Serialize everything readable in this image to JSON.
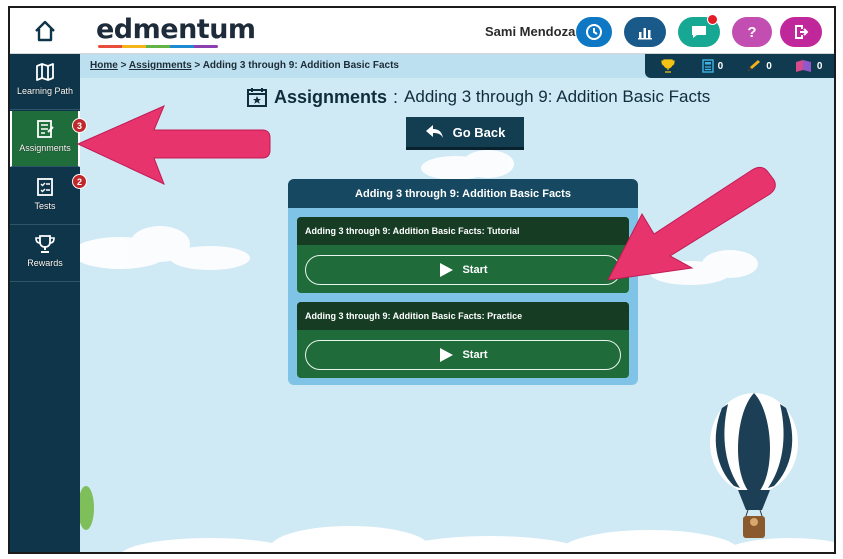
{
  "header": {
    "brand": "edmentum",
    "user_name": "Sami Mendoza",
    "icons": [
      "home-icon",
      "clock-icon",
      "chart-icon",
      "chat-icon",
      "help-icon",
      "exit-icon"
    ],
    "help_label": "?"
  },
  "sidebar": {
    "items": [
      {
        "label": "Learning Path",
        "icon": "map-icon"
      },
      {
        "label": "Assignments",
        "icon": "assignment-icon",
        "badge": "3"
      },
      {
        "label": "Tests",
        "icon": "checklist-icon",
        "badge": "2"
      },
      {
        "label": "Rewards",
        "icon": "trophy-icon"
      }
    ]
  },
  "breadcrumb": {
    "home": "Home",
    "sep1": ">",
    "assignments": "Assignments",
    "sep2": ">",
    "current": "Adding 3 through 9: Addition Basic Facts"
  },
  "stats": {
    "trophies": "",
    "calculator": "0",
    "pencil": "0",
    "flag": "0"
  },
  "page": {
    "title_strong": "Assignments",
    "title_sep": ":",
    "title_sub": "Adding 3 through 9: Addition Basic Facts",
    "go_back": "Go Back"
  },
  "card": {
    "header": "Adding 3 through 9: Addition Basic Facts",
    "activities": [
      {
        "title": "Adding 3 through 9: Addition Basic Facts: Tutorial",
        "button": "Start"
      },
      {
        "title": "Adding 3 through 9: Addition Basic Facts: Practice",
        "button": "Start"
      }
    ]
  },
  "colors": {
    "sidebar": "#0e3549",
    "active": "#1f6d3b",
    "card_header": "#164961",
    "annotation_arrow": "#e8346c"
  }
}
